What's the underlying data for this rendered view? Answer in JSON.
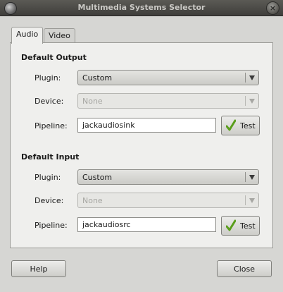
{
  "window": {
    "title": "Multimedia Systems Selector"
  },
  "tabs": [
    {
      "label": "Audio",
      "active": true
    },
    {
      "label": "Video",
      "active": false
    }
  ],
  "output": {
    "heading": "Default Output",
    "plugin_label": "Plugin:",
    "plugin_value": "Custom",
    "device_label": "Device:",
    "device_value": "None",
    "pipeline_label": "Pipeline:",
    "pipeline_value": "jackaudiosink",
    "test_label": "Test"
  },
  "input": {
    "heading": "Default Input",
    "plugin_label": "Plugin:",
    "plugin_value": "Custom",
    "device_label": "Device:",
    "device_value": "None",
    "pipeline_label": "Pipeline:",
    "pipeline_value": "jackaudiosrc",
    "test_label": "Test"
  },
  "buttons": {
    "help": "Help",
    "close": "Close"
  },
  "icons": {
    "app": "multimedia-icon",
    "close": "close-icon",
    "test": "checkmark-icon"
  },
  "colors": {
    "titlebar": "#4c4b47",
    "check": "#5a9e1c"
  }
}
